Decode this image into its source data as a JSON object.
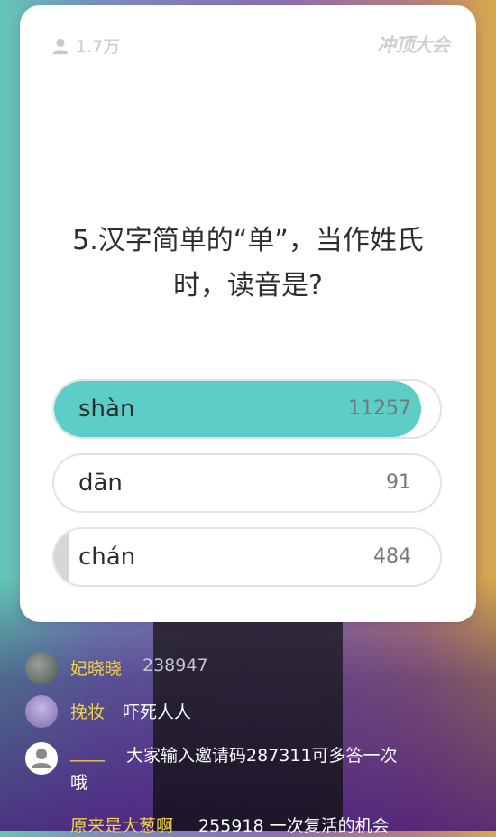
{
  "card": {
    "viewer_count": "1.7万",
    "brand": "冲顶大会",
    "question_line1": "5.汉字简单的“单”，当作姓氏",
    "question_line2": "时，读音是?",
    "options": [
      {
        "label": "shàn",
        "count": "11257",
        "fill_fraction": 0.95,
        "fill_color": "#5ccdc7"
      },
      {
        "label": "dān",
        "count": "91",
        "fill_fraction": 0.0
      },
      {
        "label": "chán",
        "count": "484",
        "fill_fraction": 0.04,
        "fill_color": "#d6d6d6"
      }
    ]
  },
  "comments": [
    {
      "user": "妃晓晓",
      "message": "238947"
    },
    {
      "user": "挽妆",
      "message": "吓死人人"
    },
    {
      "user": "____",
      "message_line1": "大家输入邀请码287311可多答一次",
      "message_line2": "哦"
    },
    {
      "user": "原来是大葱啊",
      "message": "255918 一次复活的机会"
    }
  ],
  "colors": {
    "accent": "#5ccdc7",
    "username": "#f0d24a"
  }
}
